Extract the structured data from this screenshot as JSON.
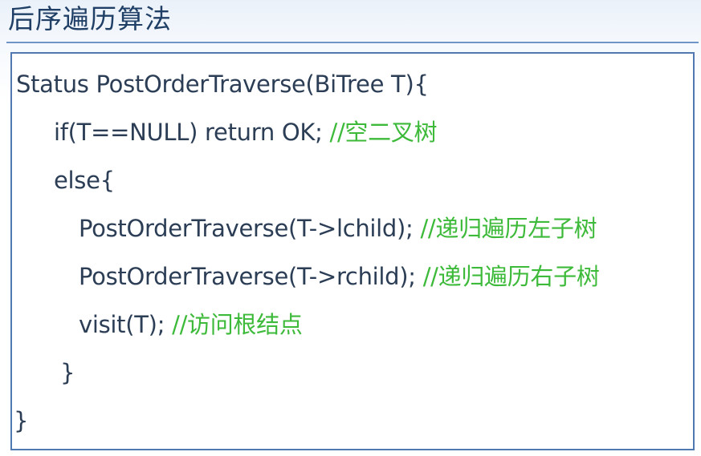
{
  "slide": {
    "title": "后序遍历算法"
  },
  "code": {
    "lines": [
      {
        "code": "Status PostOrderTraverse(BiTree T){",
        "comment": ""
      },
      {
        "code": "if(T==NULL) return OK; ",
        "comment": "//空二叉树"
      },
      {
        "code": "else{",
        "comment": ""
      },
      {
        "code": "PostOrderTraverse(T->lchild); ",
        "comment": "//递归遍历左子树"
      },
      {
        "code": "PostOrderTraverse(T->rchild); ",
        "comment": "//递归遍历右子树"
      },
      {
        "code": "visit(T);  ",
        "comment": "//访问根结点"
      },
      {
        "code": "}",
        "comment": ""
      },
      {
        "code": "}",
        "comment": ""
      }
    ]
  },
  "colors": {
    "code_text": "#2c3e56",
    "comment": "#3dba3a",
    "frame_border": "#4f79b0",
    "title": "#1f3f66"
  }
}
